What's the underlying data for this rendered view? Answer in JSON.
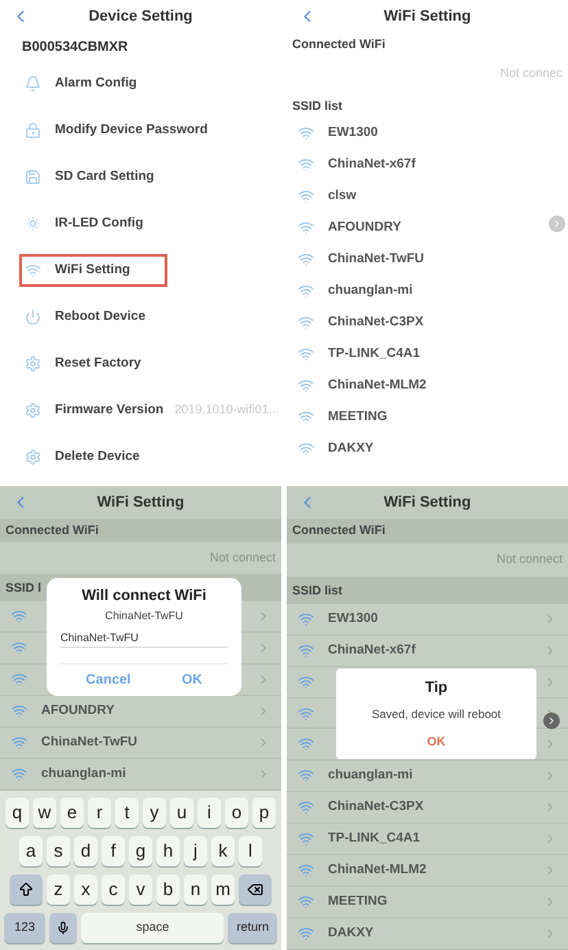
{
  "device_setting": {
    "title": "Device Setting",
    "device_id": "B000534CBMXR",
    "items": [
      {
        "label": "Alarm Config",
        "highlighted": false
      },
      {
        "label": "Modify Device Password",
        "highlighted": false
      },
      {
        "label": "SD Card Setting",
        "highlighted": false
      },
      {
        "label": "IR-LED Config",
        "highlighted": false
      },
      {
        "label": "WiFi Setting",
        "highlighted": true
      },
      {
        "label": "Reboot Device",
        "highlighted": false
      },
      {
        "label": "Reset Factory",
        "highlighted": false
      },
      {
        "label": "Firmware Version",
        "value": "2019.1010-wifi01...",
        "highlighted": false
      },
      {
        "label": "Delete Device",
        "highlighted": false
      }
    ]
  },
  "wifi_setting": {
    "title": "WiFi Setting",
    "connected_label": "Connected WiFi",
    "status": "Not connec",
    "ssid_label": "SSID list",
    "networks": [
      {
        "name": "EW1300"
      },
      {
        "name": "ChinaNet-x67f"
      },
      {
        "name": "clsw"
      },
      {
        "name": "AFOUNDRY"
      },
      {
        "name": "ChinaNet-TwFU"
      },
      {
        "name": "chuanglan-mi"
      },
      {
        "name": "ChinaNet-C3PX"
      },
      {
        "name": "TP-LINK_C4A1"
      },
      {
        "name": "ChinaNet-MLM2"
      },
      {
        "name": "MEETING"
      },
      {
        "name": "DAKXY"
      }
    ]
  },
  "connect_screen": {
    "title": "WiFi Setting",
    "connected_label": "Connected WiFi",
    "status": "Not connect",
    "ssid_label": "SSID l",
    "networks": [
      {
        "kind": "covered"
      },
      {
        "kind": "covered"
      },
      {
        "kind": "covered"
      },
      {
        "kind": "shown",
        "name": "AFOUNDRY"
      },
      {
        "kind": "shown",
        "name": "ChinaNet-TwFU"
      },
      {
        "kind": "shown",
        "name": "chuanglan-mi"
      }
    ],
    "dialog": {
      "title": "Will connect WiFi",
      "subtitle": "ChinaNet-TwFU",
      "ssid_value": "ChinaNet-TwFU",
      "buttons": [
        "Cancel",
        "OK"
      ]
    },
    "keyboard": [
      [
        {
          "kind": "letter",
          "label": "q"
        },
        {
          "kind": "letter",
          "label": "w"
        },
        {
          "kind": "letter",
          "label": "e"
        },
        {
          "kind": "letter",
          "label": "r"
        },
        {
          "kind": "letter",
          "label": "t"
        },
        {
          "kind": "letter",
          "label": "y"
        },
        {
          "kind": "letter",
          "label": "u"
        },
        {
          "kind": "letter",
          "label": "i"
        },
        {
          "kind": "letter",
          "label": "o"
        },
        {
          "kind": "letter",
          "label": "p"
        }
      ],
      [
        {
          "kind": "letter",
          "label": "a"
        },
        {
          "kind": "letter",
          "label": "s"
        },
        {
          "kind": "letter",
          "label": "d"
        },
        {
          "kind": "letter",
          "label": "f"
        },
        {
          "kind": "letter",
          "label": "g"
        },
        {
          "kind": "letter",
          "label": "h"
        },
        {
          "kind": "letter",
          "label": "j"
        },
        {
          "kind": "letter",
          "label": "k"
        },
        {
          "kind": "letter",
          "label": "l"
        }
      ],
      [
        {
          "kind": "shift"
        },
        {
          "kind": "letter",
          "label": "z"
        },
        {
          "kind": "letter",
          "label": "x"
        },
        {
          "kind": "letter",
          "label": "c"
        },
        {
          "kind": "letter",
          "label": "v"
        },
        {
          "kind": "letter",
          "label": "b"
        },
        {
          "kind": "letter",
          "label": "n"
        },
        {
          "kind": "letter",
          "label": "m"
        },
        {
          "kind": "delete"
        }
      ],
      [
        {
          "kind": "function",
          "label": "123"
        },
        {
          "kind": "mic"
        },
        {
          "kind": "space",
          "label": "space"
        },
        {
          "kind": "function",
          "label": "return"
        }
      ]
    ]
  },
  "tip_screen": {
    "title": "WiFi Setting",
    "connected_label": "Connected WiFi",
    "status": "Not connect",
    "ssid_label": "SSID list",
    "networks": [
      {
        "kind": "shown",
        "name": "EW1300"
      },
      {
        "kind": "shown",
        "name": "ChinaNet-x67f"
      },
      {
        "kind": "covered"
      },
      {
        "kind": "covered"
      },
      {
        "kind": "covered"
      },
      {
        "kind": "shown",
        "name": "chuanglan-mi"
      },
      {
        "kind": "shown",
        "name": "ChinaNet-C3PX"
      },
      {
        "kind": "shown",
        "name": "TP-LINK_C4A1"
      },
      {
        "kind": "shown",
        "name": "ChinaNet-MLM2"
      },
      {
        "kind": "shown",
        "name": "MEETING"
      },
      {
        "kind": "shown",
        "name": "DAKXY"
      }
    ],
    "dialog": {
      "title": "Tip",
      "message": "Saved, device will reboot",
      "button": "OK"
    }
  }
}
